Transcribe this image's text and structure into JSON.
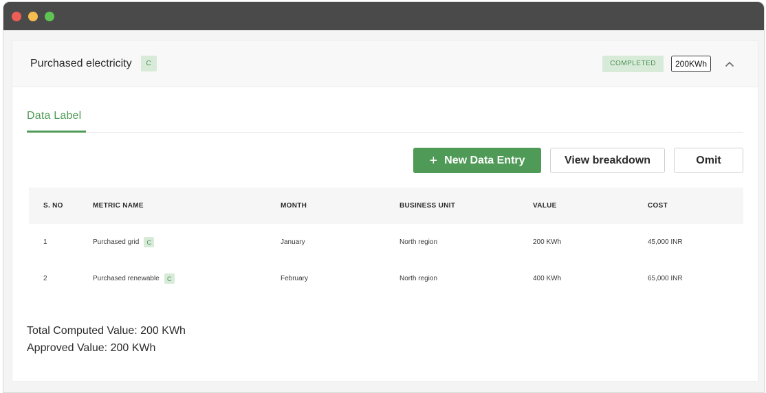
{
  "window": {
    "controls": [
      "close",
      "minimize",
      "maximize"
    ]
  },
  "header": {
    "title": "Purchased electricity",
    "badge": "C",
    "status": "COMPLETED",
    "value": "200KWh",
    "toggle_icon": "chevron-up-icon"
  },
  "tabs": [
    {
      "label": "Data Label",
      "active": true
    }
  ],
  "actions": {
    "new_entry_icon": "+",
    "new_entry_label": "New Data Entry",
    "breakdown_label": "View breakdown",
    "omit_label": "Omit"
  },
  "table": {
    "columns": [
      "S. NO",
      "METRIC NAME",
      "MONTH",
      "BUSINESS UNIT",
      "VALUE",
      "COST"
    ],
    "rows": [
      {
        "sno": "1",
        "metric": "Purchased grid",
        "badge": "C",
        "month": "January",
        "unit": "North region",
        "value": "200 KWh",
        "cost": "45,000 INR"
      },
      {
        "sno": "2",
        "metric": "Purchased renewable",
        "badge": "C",
        "month": "February",
        "unit": "North region",
        "value": "400 KWh",
        "cost": "65,000 INR"
      }
    ]
  },
  "summary": {
    "total_computed": "Total Computed Value: 200 KWh",
    "approved": "Approved Value: 200 KWh"
  },
  "colors": {
    "accent": "#4f9a56",
    "badge_bg": "#d7ebd8",
    "titlebar": "#4a4a4a"
  }
}
